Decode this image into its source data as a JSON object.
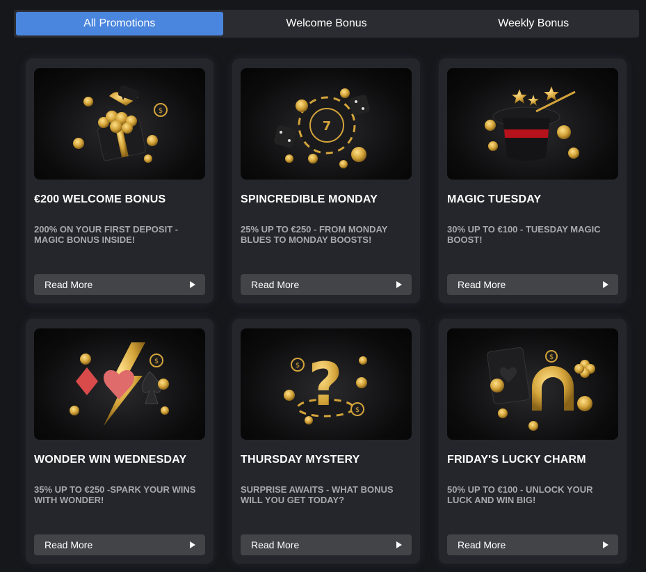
{
  "tabs": [
    {
      "label": "All Promotions",
      "active": true
    },
    {
      "label": "Welcome Bonus",
      "active": false
    },
    {
      "label": "Weekly Bonus",
      "active": false
    }
  ],
  "promotions": [
    {
      "title": "€200 WELCOME BONUS",
      "description": "200% ON YOUR FIRST DEPOSIT - MAGIC BONUS INSIDE!",
      "button": "Read More",
      "image_icon": "gift-box-coins-icon"
    },
    {
      "title": "SPINCREDIBLE MONDAY",
      "description": "25% UP TO €250 - FROM MONDAY BLUES TO MONDAY BOOSTS!",
      "button": "Read More",
      "image_icon": "casino-chip-dice-icon"
    },
    {
      "title": "MAGIC TUESDAY",
      "description": "30% UP TO €100 - TUESDAY MAGIC BOOST!",
      "button": "Read More",
      "image_icon": "magic-hat-icon"
    },
    {
      "title": "WONDER WIN WEDNESDAY",
      "description": "35% UP TO €250 -SPARK YOUR WINS WITH WONDER!",
      "button": "Read More",
      "image_icon": "card-suits-lightning-icon"
    },
    {
      "title": "THURSDAY MYSTERY",
      "description": "SURPRISE AWAITS - WHAT BONUS WILL YOU GET TODAY?",
      "button": "Read More",
      "image_icon": "question-mark-chip-icon"
    },
    {
      "title": "FRIDAY'S LUCKY CHARM",
      "description": "50% UP TO €100 - UNLOCK YOUR LUCK AND WIN BIG!",
      "button": "Read More",
      "image_icon": "horseshoe-clover-icon"
    }
  ],
  "colors": {
    "accent": "#4a86de",
    "background": "#16171b",
    "card": "#25262b",
    "button": "#434448",
    "gold": "#d4a43a"
  }
}
